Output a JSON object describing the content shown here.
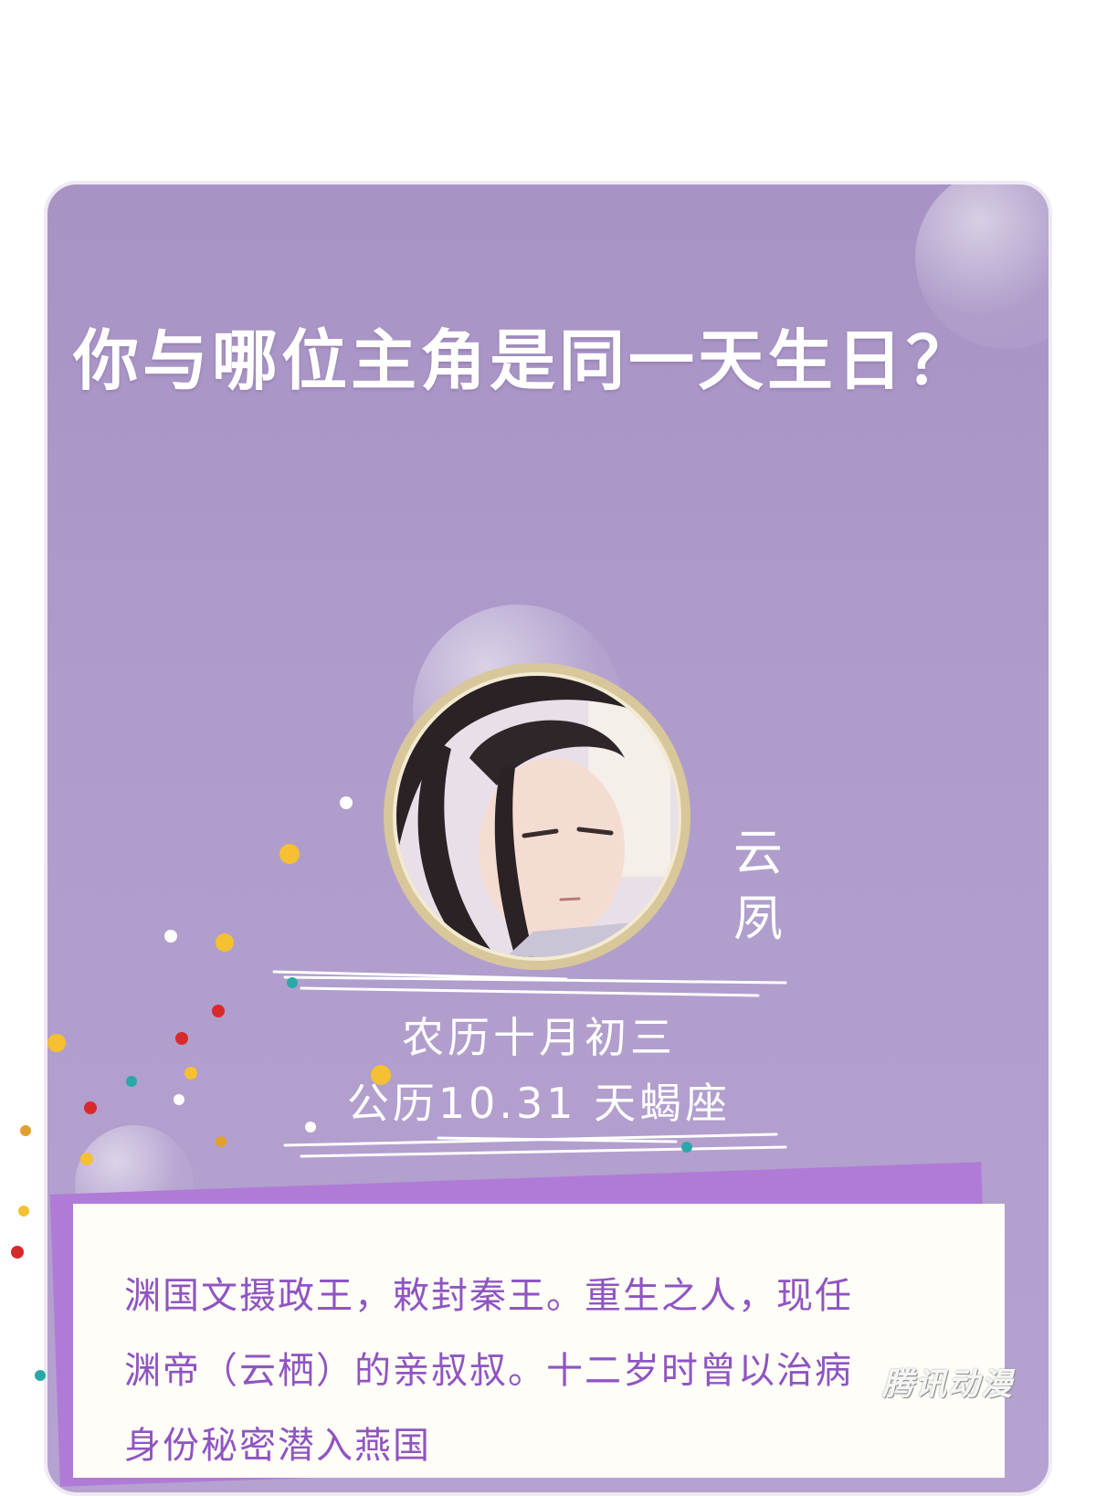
{
  "header": {
    "title": "你与哪位主角是同一天生日？"
  },
  "character": {
    "name_line_1": "云",
    "name_line_2": "夙",
    "lunar_date": "农历十月初三",
    "solar_date": "公历10.31 天蝎座"
  },
  "bio": {
    "lines": [
      "渊国文摄政王，敕封秦王。重生之人，现任",
      "渊帝（云栖）的亲叔叔。十二岁时曾以治病",
      "身份秘密潜入燕国"
    ]
  },
  "watermark": {
    "text": "腾讯动漫"
  },
  "colors": {
    "card_background": "#ae9ccb",
    "title_text": "#ffffff",
    "bio_text": "#8f55c2",
    "panel_accent": "#b07bd6",
    "avatar_ring": "#d8c79a"
  },
  "icons": {
    "avatar": "character-portrait"
  }
}
